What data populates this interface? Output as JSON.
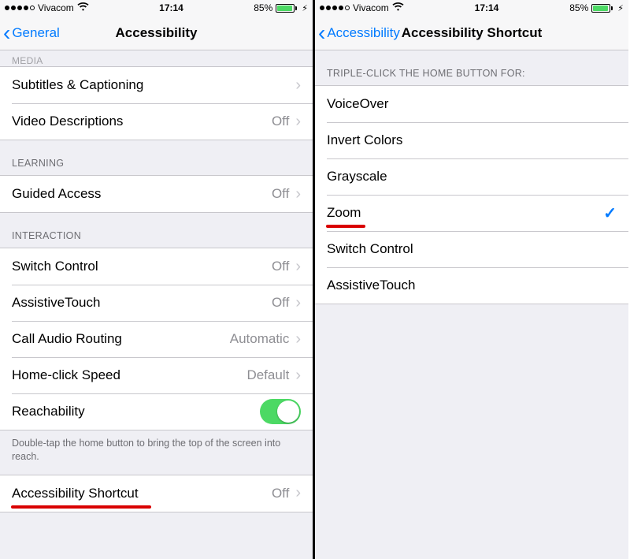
{
  "status": {
    "carrier": "Vivacom",
    "time": "17:14",
    "battery": "85%"
  },
  "left": {
    "back": "General",
    "title": "Accessibility",
    "media_header": "MEDIA",
    "rows_media": [
      {
        "label": "Subtitles & Captioning",
        "value": ""
      },
      {
        "label": "Video Descriptions",
        "value": "Off"
      }
    ],
    "learning_header": "LEARNING",
    "rows_learning": [
      {
        "label": "Guided Access",
        "value": "Off"
      }
    ],
    "interaction_header": "INTERACTION",
    "rows_interaction": [
      {
        "label": "Switch Control",
        "value": "Off"
      },
      {
        "label": "AssistiveTouch",
        "value": "Off"
      },
      {
        "label": "Call Audio Routing",
        "value": "Automatic"
      },
      {
        "label": "Home-click Speed",
        "value": "Default"
      }
    ],
    "reachability": "Reachability",
    "reach_note": "Double-tap the home button to bring the top of the screen into reach.",
    "shortcut": {
      "label": "Accessibility Shortcut",
      "value": "Off"
    }
  },
  "right": {
    "back": "Accessibility",
    "title": "Accessibility Shortcut",
    "header": "TRIPLE-CLICK THE HOME BUTTON FOR:",
    "items": [
      {
        "label": "VoiceOver",
        "checked": false
      },
      {
        "label": "Invert Colors",
        "checked": false
      },
      {
        "label": "Grayscale",
        "checked": false
      },
      {
        "label": "Zoom",
        "checked": true
      },
      {
        "label": "Switch Control",
        "checked": false
      },
      {
        "label": "AssistiveTouch",
        "checked": false
      }
    ]
  }
}
